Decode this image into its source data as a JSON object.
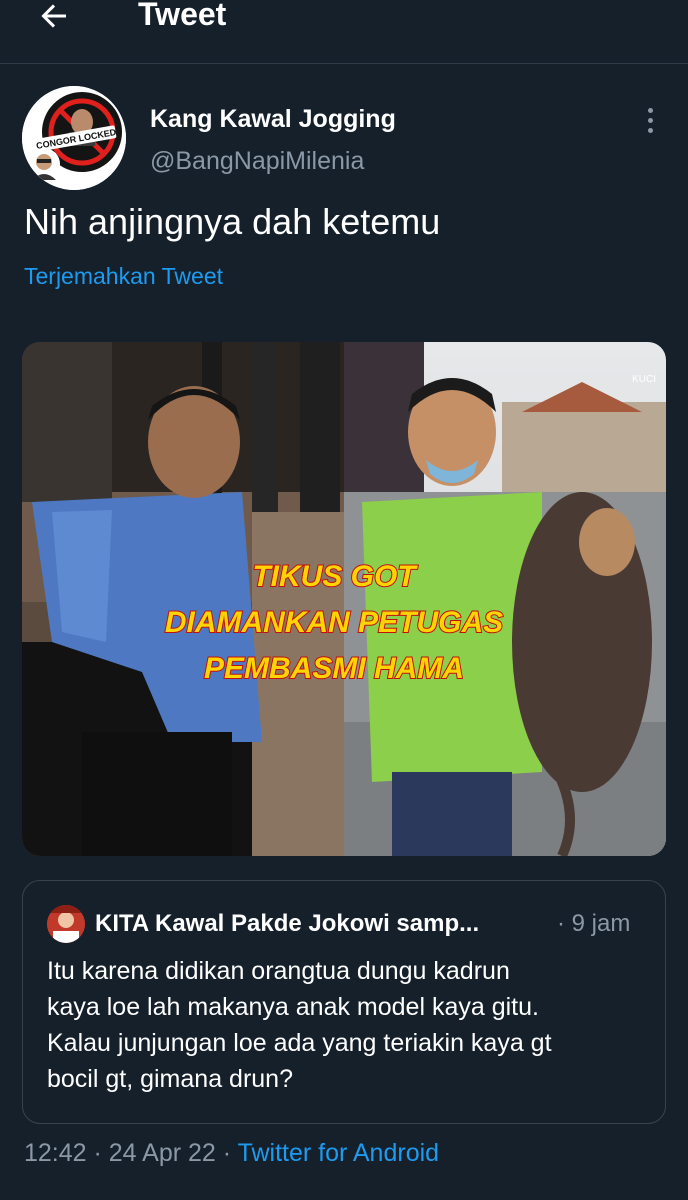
{
  "header": {
    "title": "Tweet"
  },
  "author": {
    "display_name": "Kang Kawal Jogging",
    "handle": "@BangNapiMilenia",
    "avatar_badge_text": "CONGOR LOCKED"
  },
  "tweet": {
    "text": "Nih anjingnya dah ketemu",
    "translate_label": "Terjemahkan Tweet",
    "image_caption": [
      "TIKUS GOT",
      "DIAMANKAN PETUGAS",
      "PEMBASMI HAMA"
    ],
    "image_watermark": "KUCI"
  },
  "quote": {
    "name": "KITA Kawal Pakde Jokowi samp...",
    "time": "· 9 jam",
    "text": "Itu karena didikan orangtua dungu kadrun\nkaya loe lah makanya anak model kaya gitu.\nKalau junjungan loe ada yang teriakin kaya gt\nbocil gt, gimana drun?"
  },
  "meta": {
    "time": "12:42",
    "sep1": " · ",
    "date": "24 Apr 22",
    "sep2": " · ",
    "source": "Twitter for Android"
  },
  "colors": {
    "background": "#15202b",
    "accent": "#1d9bf0",
    "secondary_text": "#8b98a5",
    "border": "#38444d"
  },
  "icons": [
    "back-arrow-icon",
    "more-vertical-icon"
  ]
}
